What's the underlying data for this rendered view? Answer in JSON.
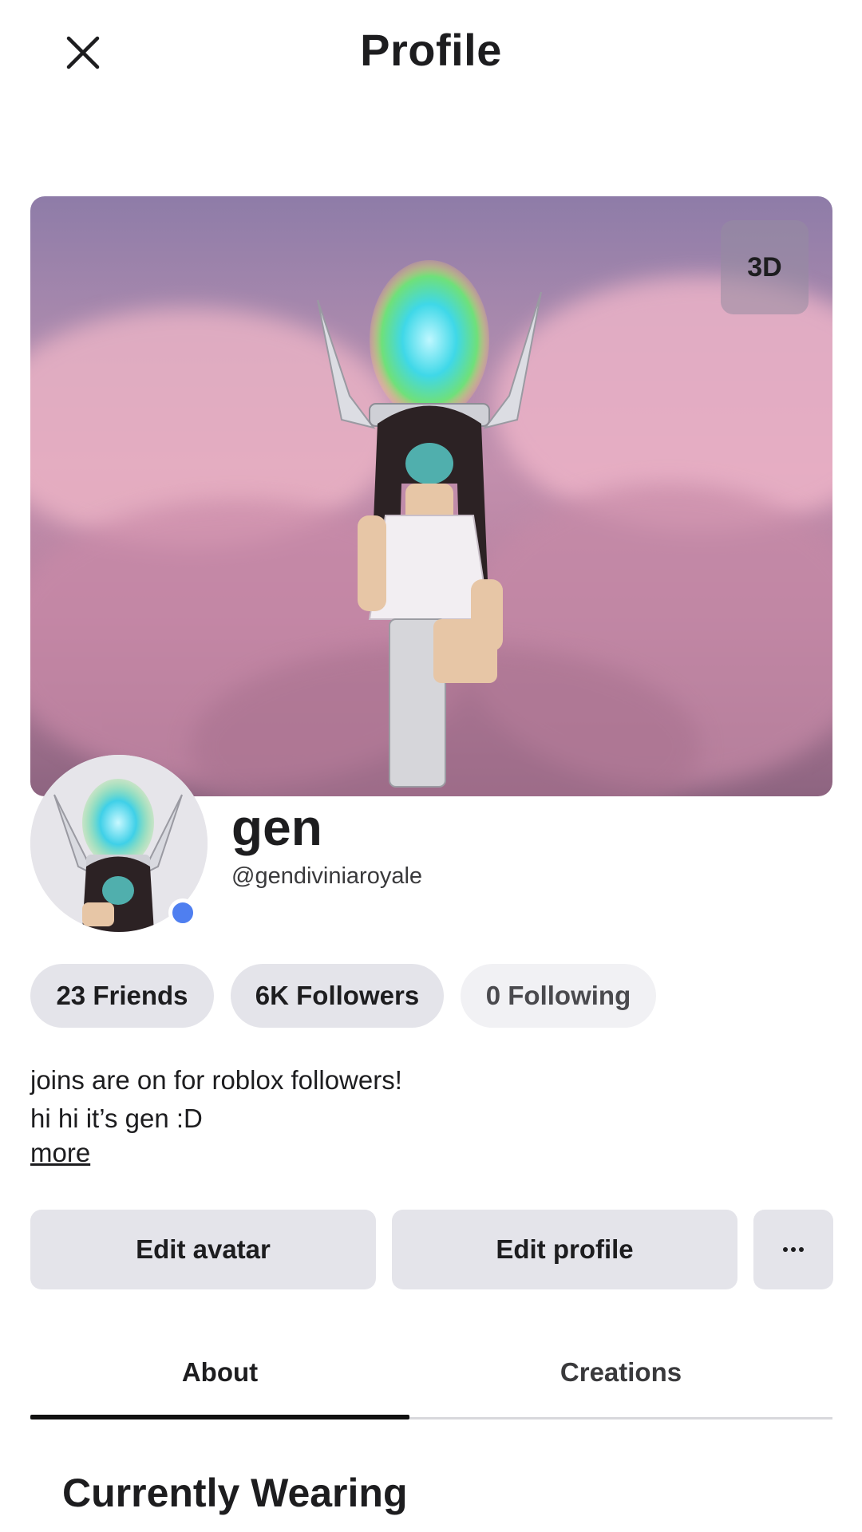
{
  "header": {
    "title": "Profile"
  },
  "banner": {
    "badge_label": "3D"
  },
  "profile": {
    "display_name": "gen",
    "username": "@gendiviniaroyale",
    "online_status_color": "#4f7ff0"
  },
  "stats": {
    "friends": "23 Friends",
    "followers": "6K Followers",
    "following": "0 Following"
  },
  "bio": {
    "line1": "joins are on for roblox followers!",
    "line2": "hi hi it’s gen :D",
    "more_label": "more"
  },
  "actions": {
    "edit_avatar": "Edit avatar",
    "edit_profile": "Edit profile"
  },
  "tabs": [
    {
      "label": "About",
      "active": true
    },
    {
      "label": "Creations",
      "active": false
    }
  ],
  "section": {
    "title": "Currently Wearing"
  },
  "colors": {
    "accent_dark": "#111111",
    "pill_bg": "#e4e4ea",
    "online": "#4f7ff0"
  }
}
